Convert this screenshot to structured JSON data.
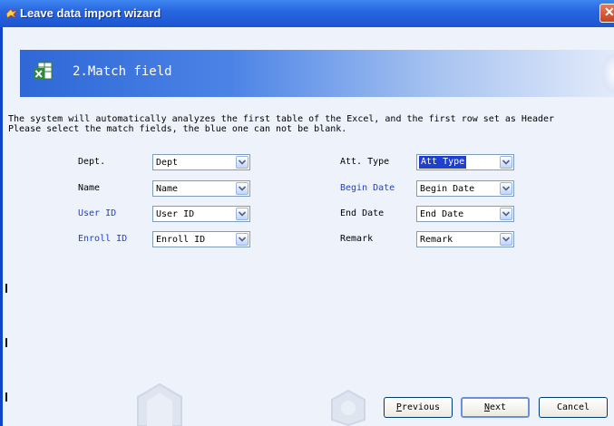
{
  "window": {
    "title": "Leave data import wizard",
    "close_glyph": "✕"
  },
  "step": {
    "title": "2.Match field",
    "icon": "excel-icon"
  },
  "description": {
    "line1": "The system will automatically analyzes the first table of the Excel, and the first row set as Header",
    "line2": "Please select the match fields, the blue one can not be blank."
  },
  "colors": {
    "required_label": "#1e3fcf",
    "titlebar": "#2866e0",
    "banner": "#2f68d6"
  },
  "fields_left": [
    {
      "label": "Dept.",
      "value": "Dept",
      "required": false
    },
    {
      "label": "Name",
      "value": "Name",
      "required": false
    },
    {
      "label": "User ID",
      "value": "User ID",
      "required": true
    },
    {
      "label": "Enroll ID",
      "value": "Enroll ID",
      "required": true
    }
  ],
  "fields_right": [
    {
      "label": "Att. Type",
      "value": "Att Type",
      "required": false,
      "focused": true
    },
    {
      "label": "Begin Date",
      "value": "Begin Date",
      "required": true
    },
    {
      "label": "End Date",
      "value": "End Date",
      "required": false
    },
    {
      "label": "Remark",
      "value": "Remark",
      "required": false
    }
  ],
  "buttons": {
    "previous": {
      "accel": "P",
      "rest": "revious"
    },
    "next": {
      "accel": "N",
      "rest": "ext"
    },
    "cancel": "Cancel"
  }
}
